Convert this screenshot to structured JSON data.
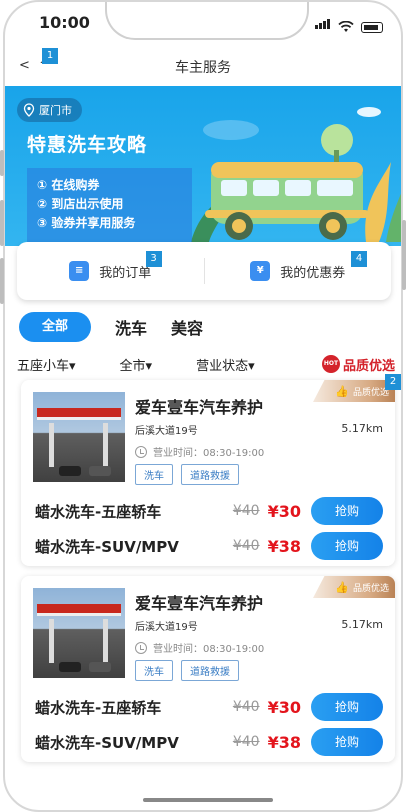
{
  "status": {
    "time": "10:00"
  },
  "nav": {
    "back": "<",
    "home": "^",
    "title": "车主服务",
    "badge": "1"
  },
  "banner": {
    "city": "厦门市",
    "title": "特惠洗车攻略",
    "steps": [
      "① 在线购券",
      "② 到店出示使用",
      "③ 验券并享用服务"
    ]
  },
  "quick": [
    {
      "label": "我的订单",
      "icon": "order-icon",
      "badge": "3"
    },
    {
      "label": "我的优惠券",
      "icon": "coupon-icon",
      "icon_text": "¥",
      "badge": "4"
    }
  ],
  "tabs": {
    "active": "全部",
    "items": [
      "洗车",
      "美容"
    ]
  },
  "filters": {
    "items": [
      "五座小车▾",
      "全市▾",
      "营业状态▾"
    ],
    "quality": "品质优选",
    "hot": "HOT"
  },
  "cards": [
    {
      "badge": "2",
      "ribbon": "品质优选",
      "name": "爱车壹车汽车养护",
      "address": "后溪大道19号",
      "distance": "5.17km",
      "hours": "营业时间：08:30-19:00",
      "tags": [
        "洗车",
        "道路救援"
      ],
      "packages": [
        {
          "name": "蜡水洗车-五座轿车",
          "old": "¥40",
          "price": "¥30",
          "button": "抢购"
        },
        {
          "name": "蜡水洗车-SUV/MPV",
          "old": "¥40",
          "price": "¥38",
          "button": "抢购"
        }
      ]
    },
    {
      "ribbon": "品质优选",
      "name": "爱车壹车汽车养护",
      "address": "后溪大道19号",
      "distance": "5.17km",
      "hours": "营业时间：08:30-19:00",
      "tags": [
        "洗车",
        "道路救援"
      ],
      "packages": [
        {
          "name": "蜡水洗车-五座轿车",
          "old": "¥40",
          "price": "¥30",
          "button": "抢购"
        },
        {
          "name": "蜡水洗车-SUV/MPV",
          "old": "¥40",
          "price": "¥38",
          "button": "抢购"
        }
      ]
    }
  ]
}
